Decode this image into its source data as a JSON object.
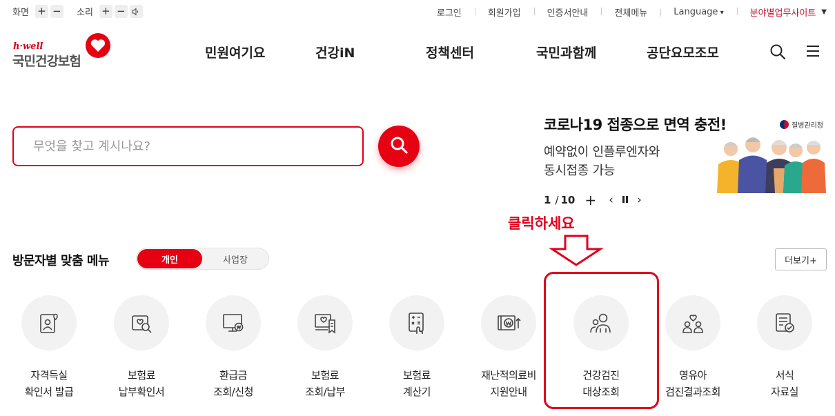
{
  "util": {
    "screen_label": "화면",
    "sound_label": "소리",
    "plus": "+",
    "minus": "−",
    "speaker_icon": "speaker-icon",
    "links": [
      "로그인",
      "회원가입",
      "인증서안내",
      "전체메뉴"
    ],
    "language": "Language",
    "biz_site": "분야별업무사이트"
  },
  "logo": {
    "sub": "h·well",
    "name": "국민건강보험"
  },
  "gnb": [
    "민원여기요",
    "건강iN",
    "정책센터",
    "국민과함께",
    "공단요모조모"
  ],
  "search": {
    "placeholder": "무엇을 찾고 계시나요?"
  },
  "banner": {
    "headline": "코로나19 접종으로 면역 충전!",
    "sub_line1": "예약없이 인플루엔자와",
    "sub_line2": "동시접종 가능",
    "agency": "질병관리청",
    "page_current": "1",
    "page_sep": "/",
    "page_total": "10"
  },
  "annotation": {
    "text": "클릭하세요"
  },
  "section": {
    "title": "방문자별 맞춤 메뉴",
    "tab_personal": "개인",
    "tab_business": "사업장",
    "more": "더보기+"
  },
  "menu": [
    {
      "line1": "자격득실",
      "line2": "확인서 발급",
      "icon": "id-card-icon"
    },
    {
      "line1": "보험료",
      "line2": "납부확인서",
      "icon": "search-document-icon"
    },
    {
      "line1": "환급금",
      "line2": "조회/신청",
      "icon": "monitor-won-icon"
    },
    {
      "line1": "보험료",
      "line2": "조회/납부",
      "icon": "receipt-icon"
    },
    {
      "line1": "보험료",
      "line2": "계산기",
      "icon": "calculator-icon"
    },
    {
      "line1": "재난적의료비",
      "line2": "지원안내",
      "icon": "won-support-icon"
    },
    {
      "line1": "건강검진",
      "line2": "대상조회",
      "icon": "checkup-people-icon"
    },
    {
      "line1": "영유아",
      "line2": "검진결과조회",
      "icon": "family-icon"
    },
    {
      "line1": "서식",
      "line2": "자료실",
      "icon": "form-document-icon"
    }
  ],
  "colors": {
    "brand_red": "#e60012",
    "annotation_red": "#e0001b"
  }
}
